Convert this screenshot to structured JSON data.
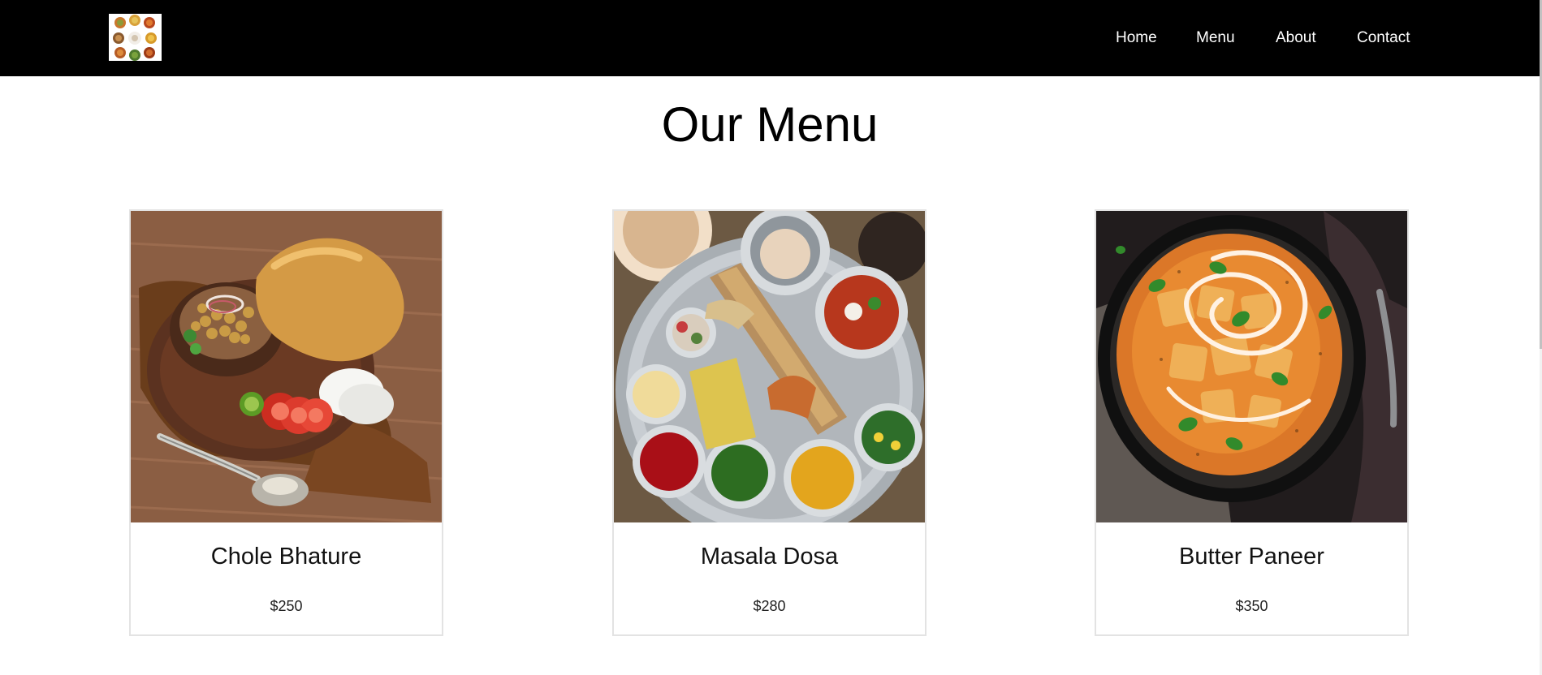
{
  "nav": {
    "logo_icon": "food-platter-logo-icon",
    "items": [
      {
        "label": "Home"
      },
      {
        "label": "Menu"
      },
      {
        "label": "About"
      },
      {
        "label": "Contact"
      }
    ]
  },
  "main": {
    "title": "Our Menu",
    "cards": [
      {
        "name": "Chole Bhature",
        "price": "$250",
        "image_icon": "chole-bhature-photo"
      },
      {
        "name": "Masala Dosa",
        "price": "$280",
        "image_icon": "masala-dosa-photo"
      },
      {
        "name": "Butter Paneer",
        "price": "$350",
        "image_icon": "butter-paneer-photo"
      }
    ]
  },
  "colors": {
    "nav_background": "#000000",
    "nav_text": "#ffffff",
    "page_background": "#ffffff",
    "card_border": "#e3e3e3"
  }
}
